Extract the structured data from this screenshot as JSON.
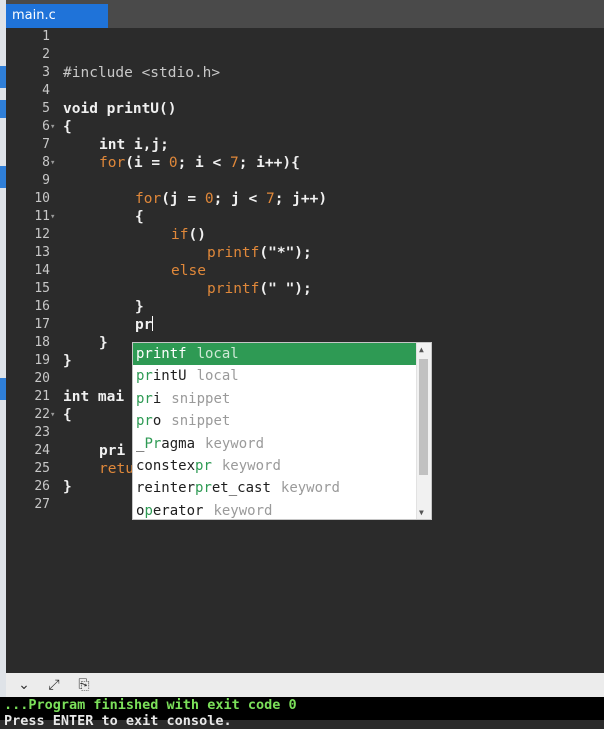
{
  "tab": {
    "label": "main.c"
  },
  "editor": {
    "line_numbers": [
      "1",
      "2",
      "3",
      "4",
      "5",
      "6",
      "7",
      "8",
      "9",
      "10",
      "11",
      "12",
      "13",
      "14",
      "15",
      "16",
      "17",
      "18",
      "19",
      "20",
      "21",
      "22",
      "23",
      "24",
      "25",
      "26",
      "27"
    ],
    "lines": {
      "l3": "#include <stdio.h>",
      "l5": "void printU()",
      "l6": "{",
      "l7": "int i,j;",
      "l8_for": "for",
      "l8_rest": "(i = ",
      "l8_n0": "0",
      "l8_mid": "; i < ",
      "l8_n7": "7",
      "l8_end": "; i++){",
      "l10_for": "for",
      "l10_rest": "(j = ",
      "l10_n0": "0",
      "l10_mid": "; j < ",
      "l10_n7": "7",
      "l10_end": "; j++)",
      "l11": "{",
      "l12_if": "if",
      "l12_rest": "()",
      "l13_fn": "printf",
      "l13_rest": "(\"*\");",
      "l14": "else",
      "l15_fn": "printf",
      "l15_rest": "(\" \");",
      "l16": "}",
      "l17": "pr",
      "l18": "}",
      "l19": "}",
      "l21": "int mai",
      "l22": "{",
      "l24": "pri",
      "l25": "retu",
      "l26": "}"
    }
  },
  "autocomplete": {
    "items": [
      {
        "match": "pr",
        "rest": "intf",
        "kind": "local"
      },
      {
        "match": "pr",
        "rest": "intU",
        "kind": "local"
      },
      {
        "match": "pr",
        "rest": "i",
        "kind": "snippet"
      },
      {
        "match": "pr",
        "rest": "o",
        "kind": "snippet"
      },
      {
        "pre": "_",
        "match": "Pr",
        "rest": "agma",
        "kind": "keyword"
      },
      {
        "pre": "constex",
        "match": "pr",
        "rest": "",
        "kind": "keyword"
      },
      {
        "pre": "reinter",
        "match": "pr",
        "rest": "et_cast",
        "kind": "keyword"
      },
      {
        "pre": "o",
        "match": "p",
        "rest": "erator",
        "kind": "keyword"
      }
    ]
  },
  "console": {
    "line1": "...Program finished with exit code 0",
    "line2": "Press ENTER to exit console."
  },
  "colors": {
    "tab": "#1f73d9",
    "selected": "#2e9a54",
    "keyword_orange": "#e0883a",
    "console_text": "#7be05a"
  }
}
